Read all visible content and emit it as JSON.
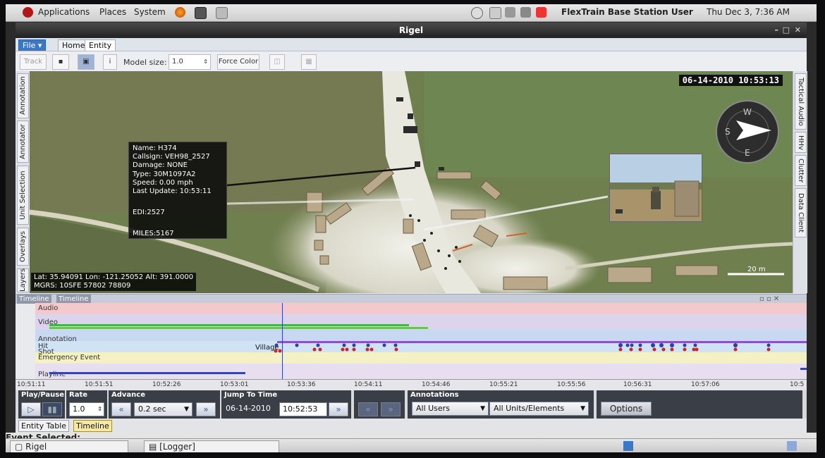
{
  "gnome_panel": {
    "menus": [
      "Applications",
      "Places",
      "System"
    ],
    "user": "FlexTrain Base Station User",
    "clock": "Thu Dec  3,  7:36 AM"
  },
  "window": {
    "title": "Rigel"
  },
  "app_tabs": [
    "File",
    "Home",
    "Entity"
  ],
  "toolbar": {
    "track_label": "Track",
    "model_size_label": "Model size:",
    "model_size_value": "1.0",
    "force_color_label": "Force Color"
  },
  "left_tabs": [
    "Annotation",
    "Annotator",
    "Unit Selection",
    "Overlays",
    "Layers"
  ],
  "right_tabs": [
    "Tactical Audio",
    "HHv",
    "Clutter",
    "Data Client"
  ],
  "map": {
    "datetime": "06-14-2010 10:53:13",
    "entity_info": {
      "name": "Name: H374",
      "callsign": "Callsign: VEH98_2527",
      "damage": "Damage: NONE",
      "type": "Type: 30M1097A2",
      "speed": "Speed: 0.00 mph",
      "last_update": "Last Update: 10:53:11",
      "edi": "EDI:2527",
      "miles": "MILES:5167"
    },
    "coords_line1": "Lat:  35.94091 Lon:  -121.25052 Alt:  391.0000",
    "coords_line2": "MGRS:  10SFE 57802 78809",
    "scale_label": "20 m"
  },
  "timeline": {
    "header_tabs": [
      "Timeline",
      "Timeline"
    ],
    "tracks": [
      "Audio",
      "Video",
      "Annotation",
      "Hit",
      "Shot",
      "Emergency Event",
      "Playline"
    ],
    "village_label": "Village",
    "ticks": [
      "10:51:11",
      "10:51:51",
      "10:52:26",
      "10:53:01",
      "10:53:36",
      "10:54:11",
      "10:54:46",
      "10:55:21",
      "10:55:56",
      "10:56:31",
      "10:57:06",
      "10:5"
    ]
  },
  "controls": {
    "play_pause_label": "Play/Pause",
    "rate_label": "Rate",
    "rate_value": "1.0",
    "advance_label": "Advance",
    "advance_value": "0.2 sec",
    "jump_label": "Jump To Time",
    "jump_date": "06-14-2010",
    "jump_time": "10:52:53",
    "annotations_label": "Annotations",
    "users_value": "All Users",
    "units_value": "All Units/Elements",
    "options_label": "Options"
  },
  "bottom_tabs": [
    "Entity Table",
    "Timeline"
  ],
  "event_selected_label": "Event Selected:",
  "taskbar": [
    "Rigel",
    "[Logger]"
  ]
}
